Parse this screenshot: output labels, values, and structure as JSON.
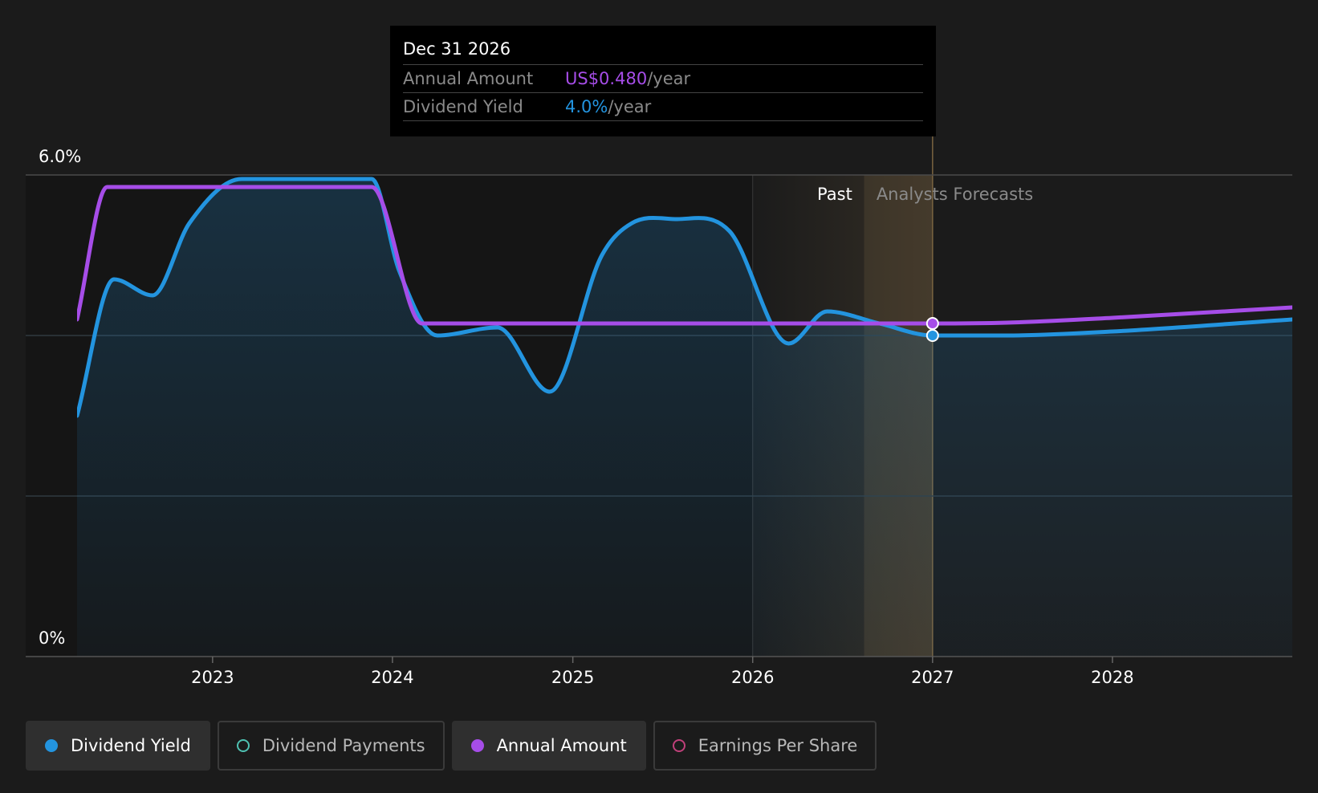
{
  "chart_data": {
    "type": "line",
    "y_unit": "%",
    "ylim": [
      0,
      6.0
    ],
    "y_tick_labels": [
      "6.0%",
      "0%"
    ],
    "x_ticks": [
      "2023",
      "2024",
      "2025",
      "2026",
      "2027",
      "2028"
    ],
    "xlim": [
      "2022-04-01",
      "2028-12-31"
    ],
    "grid": true,
    "regions": {
      "past_label": "Past",
      "forecast_label": "Analysts Forecasts",
      "forecast_start": "2027-01-01"
    },
    "series": [
      {
        "name": "Dividend Yield",
        "color": "#2394df",
        "axis": "percent",
        "points": [
          [
            "2022-04-01",
            3.0
          ],
          [
            "2022-06-15",
            4.7
          ],
          [
            "2022-09-01",
            4.5
          ],
          [
            "2022-11-15",
            5.4
          ],
          [
            "2023-03-01",
            5.95
          ],
          [
            "2023-06-01",
            5.95
          ],
          [
            "2023-09-01",
            5.95
          ],
          [
            "2023-11-20",
            5.95
          ],
          [
            "2024-01-15",
            4.8
          ],
          [
            "2024-04-01",
            4.0
          ],
          [
            "2024-08-01",
            4.1
          ],
          [
            "2024-11-15",
            3.3
          ],
          [
            "2025-03-01",
            5.0
          ],
          [
            "2025-05-01",
            5.4
          ],
          [
            "2025-08-01",
            5.45
          ],
          [
            "2025-11-15",
            5.3
          ],
          [
            "2026-03-15",
            3.9
          ],
          [
            "2026-06-01",
            4.3
          ],
          [
            "2026-09-15",
            4.15
          ],
          [
            "2027-01-01",
            4.0
          ],
          [
            "2027-06-01",
            4.0
          ],
          [
            "2028-01-01",
            4.05
          ],
          [
            "2028-12-31",
            4.2
          ]
        ]
      },
      {
        "name": "Annual Amount",
        "color": "#a64de8",
        "axis": "percent",
        "points": [
          [
            "2022-04-01",
            4.2
          ],
          [
            "2022-06-01",
            5.85
          ],
          [
            "2022-09-01",
            5.85
          ],
          [
            "2023-06-01",
            5.85
          ],
          [
            "2023-11-20",
            5.85
          ],
          [
            "2024-03-01",
            4.15
          ],
          [
            "2024-06-01",
            4.15
          ],
          [
            "2025-06-01",
            4.15
          ],
          [
            "2026-06-01",
            4.15
          ],
          [
            "2027-01-01",
            4.15
          ],
          [
            "2027-06-01",
            4.16
          ],
          [
            "2028-01-01",
            4.22
          ],
          [
            "2028-12-31",
            4.35
          ]
        ]
      }
    ]
  },
  "tooltip": {
    "date": "Dec 31 2026",
    "rows": [
      {
        "label": "Annual Amount",
        "value": "US$0.480",
        "suffix": "/year",
        "color": "#a64de8"
      },
      {
        "label": "Dividend Yield",
        "value": "4.0%",
        "suffix": "/year",
        "color": "#2394df"
      }
    ]
  },
  "legend": [
    {
      "label": "Dividend Yield",
      "color": "#2394df",
      "active": true,
      "filled": true
    },
    {
      "label": "Dividend Payments",
      "color": "#4fc1b2",
      "active": false,
      "filled": false
    },
    {
      "label": "Annual Amount",
      "color": "#a64de8",
      "active": true,
      "filled": true
    },
    {
      "label": "Earnings Per Share",
      "color": "#c0407a",
      "active": false,
      "filled": false
    }
  ]
}
